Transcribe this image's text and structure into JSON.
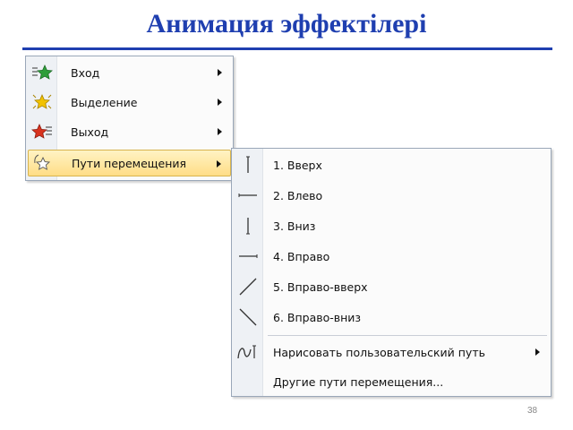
{
  "slide": {
    "title": "Анимация эффектілері",
    "page_number": "38"
  },
  "main_menu": {
    "items": [
      {
        "label": "Вход",
        "icon": "entrance-effect-icon",
        "has_submenu": true
      },
      {
        "label": "Выделение",
        "icon": "emphasis-effect-icon",
        "has_submenu": true
      },
      {
        "label": "Выход",
        "icon": "exit-effect-icon",
        "has_submenu": true
      },
      {
        "label": "Пути перемещения",
        "icon": "motion-path-icon",
        "has_submenu": true,
        "highlighted": true
      }
    ]
  },
  "sub_menu": {
    "paths": [
      {
        "label": "1. Вверх",
        "icon": "path-up-icon"
      },
      {
        "label": "2. Влево",
        "icon": "path-left-icon"
      },
      {
        "label": "3. Вниз",
        "icon": "path-down-icon"
      },
      {
        "label": "4. Вправо",
        "icon": "path-right-icon"
      },
      {
        "label": "5. Вправо-вверх",
        "icon": "path-right-up-icon"
      },
      {
        "label": "6. Вправо-вниз",
        "icon": "path-right-down-icon"
      }
    ],
    "custom_path": {
      "label": "Нарисовать пользовательский путь",
      "icon": "draw-custom-path-icon",
      "has_submenu": true
    },
    "other_paths": {
      "label": "Другие пути перемещения..."
    }
  },
  "colors": {
    "title": "#1f3fb0",
    "highlight": "#ffdd86",
    "star_green": "#2e9e3a",
    "star_yellow": "#f2c200",
    "star_red": "#d8321e"
  }
}
